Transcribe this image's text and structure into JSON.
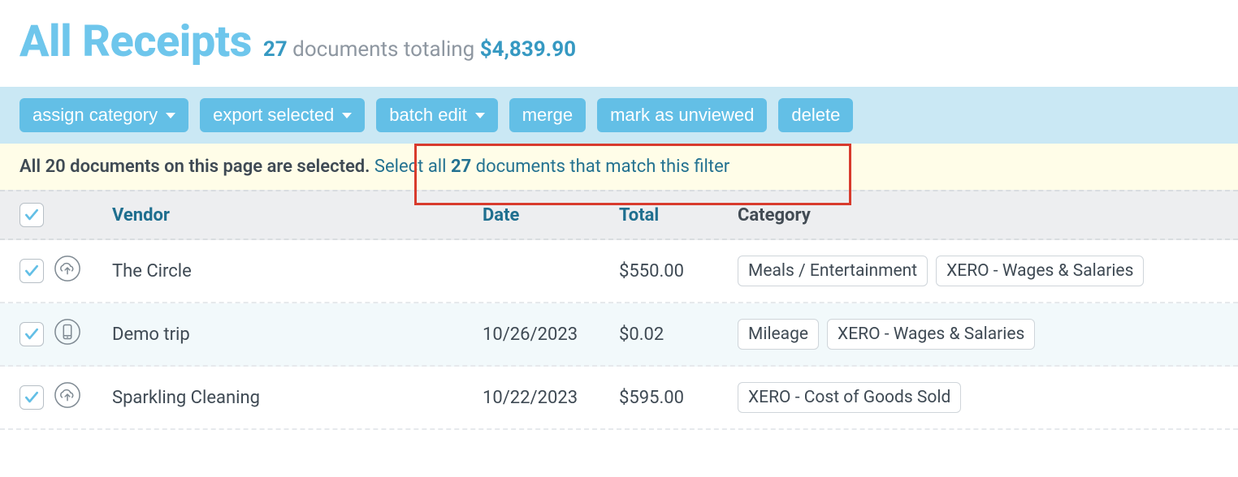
{
  "header": {
    "title": "All Receipts",
    "count": "27",
    "count_suffix": " documents totaling ",
    "total": "$4,839.90"
  },
  "toolbar": {
    "assign": "assign category",
    "export": "export selected",
    "batch": "batch edit",
    "merge": "merge",
    "unviewed": "mark as unviewed",
    "delete": "delete"
  },
  "banner": {
    "text": "All 20 documents on this page are selected. ",
    "link_prefix": "Select all ",
    "link_count": "27",
    "link_suffix": " documents that match this filter"
  },
  "columns": {
    "vendor": "Vendor",
    "date": "Date",
    "total": "Total",
    "category": "Category"
  },
  "rows": [
    {
      "icon": "cloud",
      "vendor": "The Circle",
      "date": "",
      "total": "$550.00",
      "tags": [
        "Meals / Entertainment",
        "XERO - Wages & Salaries"
      ]
    },
    {
      "icon": "phone",
      "vendor": "Demo trip",
      "date": "10/26/2023",
      "total": "$0.02",
      "tags": [
        "Mileage",
        "XERO - Wages & Salaries"
      ]
    },
    {
      "icon": "cloud",
      "vendor": "Sparkling Cleaning",
      "date": "10/22/2023",
      "total": "$595.00",
      "tags": [
        "XERO - Cost of Goods Sold"
      ]
    }
  ]
}
